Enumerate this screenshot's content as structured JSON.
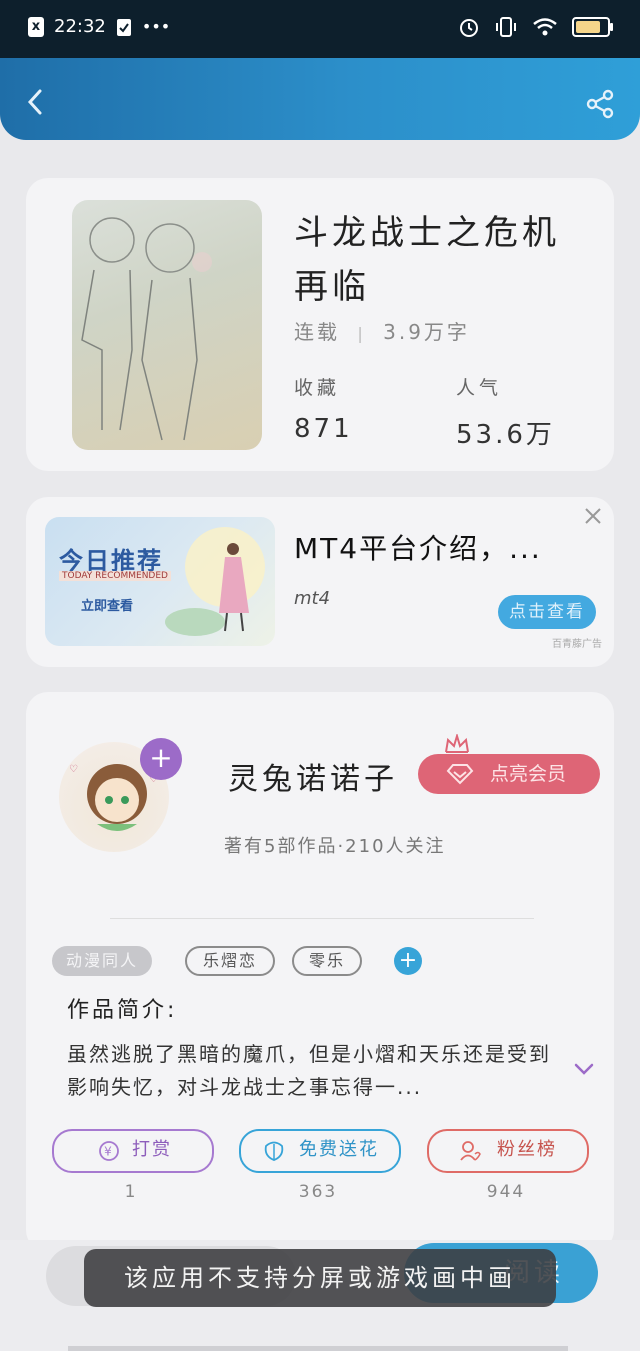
{
  "status_bar": {
    "time": "22:32",
    "more": "•••",
    "battery_level": 0.85
  },
  "header": {
    "back_icon": "back-arrow-icon",
    "share_icon": "share-icon",
    "gradient_color": "#2c8fca"
  },
  "book": {
    "title": "斗龙战士之危机再临",
    "status": "连载",
    "separator": "|",
    "word_count": "3.9万字",
    "collect_label": "收藏",
    "collect_value": "871",
    "popularity_label": "人气",
    "popularity_value": "53.6万"
  },
  "ad": {
    "image_title": "今日推荐",
    "image_subtitle": "TODAY RECOMMENDED",
    "image_cta": "立即查看",
    "title": "MT4平台介绍，...",
    "subtitle": "mt4",
    "button": "点击查看",
    "source": "百青藤广告"
  },
  "author": {
    "name": "灵兔诺诺子",
    "follow": "+",
    "vip_button": "点亮会员",
    "meta": "著有5部作品·210人关注"
  },
  "tags": {
    "items": [
      "动漫同人",
      "乐熠恋",
      "零乐"
    ],
    "add": "+"
  },
  "intro": {
    "heading": "作品简介:",
    "body": "虽然逃脱了黑暗的魔爪，但是小熠和天乐还是受到影响失忆，对斗龙战士之事忘得一..."
  },
  "actions": [
    {
      "label": "打赏",
      "count": "1",
      "icon": "yuan-icon",
      "color": "#a679d0"
    },
    {
      "label": "免费送花",
      "count": "363",
      "icon": "flower-icon",
      "color": "#37a4d8"
    },
    {
      "label": "粉丝榜",
      "count": "944",
      "icon": "fans-icon",
      "color": "#df6b66"
    }
  ],
  "bottom": {
    "read_button": "阅读"
  },
  "toast": "该应用不支持分屏或游戏画中画"
}
